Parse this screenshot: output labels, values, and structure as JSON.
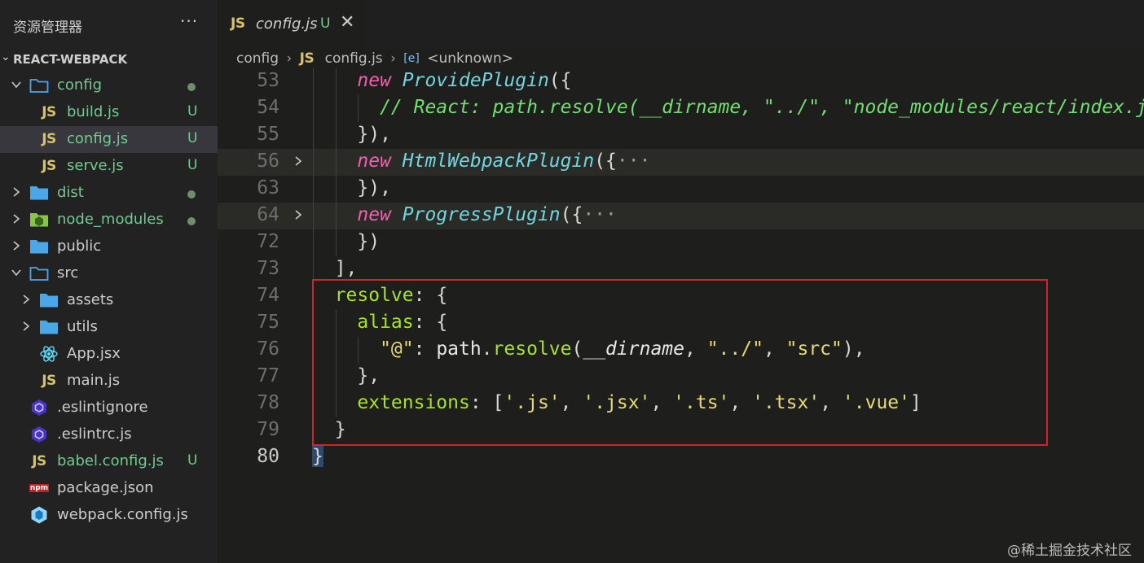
{
  "sidebar": {
    "title": "资源管理器",
    "more": "···",
    "project": "REACT-WEBPACK",
    "items": [
      {
        "name": "config",
        "type": "folder",
        "open": true,
        "depth": 0,
        "status": "dot"
      },
      {
        "name": "build.js",
        "type": "js",
        "depth": 1,
        "status": "U"
      },
      {
        "name": "config.js",
        "type": "js",
        "depth": 1,
        "status": "U",
        "selected": true
      },
      {
        "name": "serve.js",
        "type": "js",
        "depth": 1,
        "status": "U"
      },
      {
        "name": "dist",
        "type": "folder",
        "open": false,
        "depth": 0,
        "status": "dot"
      },
      {
        "name": "node_modules",
        "type": "node-folder",
        "open": false,
        "depth": 0,
        "status": "dot"
      },
      {
        "name": "public",
        "type": "folder",
        "open": false,
        "depth": 0
      },
      {
        "name": "src",
        "type": "folder",
        "open": true,
        "depth": 0
      },
      {
        "name": "assets",
        "type": "folder",
        "open": false,
        "depth": 1
      },
      {
        "name": "utils",
        "type": "folder",
        "open": false,
        "depth": 1
      },
      {
        "name": "App.jsx",
        "type": "react",
        "depth": 1
      },
      {
        "name": "main.js",
        "type": "js",
        "depth": 1
      },
      {
        "name": ".eslintignore",
        "type": "eslint",
        "depth": 0
      },
      {
        "name": ".eslintrc.js",
        "type": "eslint",
        "depth": 0
      },
      {
        "name": "babel.config.js",
        "type": "js",
        "depth": 0,
        "status": "U"
      },
      {
        "name": "package.json",
        "type": "npm",
        "depth": 0
      },
      {
        "name": "webpack.config.js",
        "type": "webpack",
        "depth": 0
      }
    ]
  },
  "icons": {
    "js": "JS",
    "npm": "npm"
  },
  "colors": {
    "accent_folder": "#4aa8e8",
    "js_yellow": "#d6c26a",
    "untracked": "#73c991",
    "modified_dot": "#6d8f6d",
    "highlight_box": "#d3232a"
  },
  "tab": {
    "label": "config.js",
    "status": "U",
    "close": "✕",
    "icon": "JS"
  },
  "breadcrumb": {
    "folder": "config",
    "file": "config.js",
    "symbol": "<unknown>",
    "symbol_icon": "[e]"
  },
  "code": [
    {
      "num": "53",
      "indent": 2,
      "tokens": [
        [
          "k",
          "new"
        ],
        [
          "p",
          " "
        ],
        [
          "cls",
          "ProvidePlugin"
        ],
        [
          "p",
          "({"
        ]
      ]
    },
    {
      "num": "54",
      "indent": 3,
      "tokens": [
        [
          "cm",
          "// React: path.resolve(__dirname, \"../\", \"node_modules/react/index.js\")"
        ]
      ]
    },
    {
      "num": "55",
      "indent": 2,
      "tokens": [
        [
          "p",
          "}),"
        ]
      ]
    },
    {
      "num": "56",
      "indent": 2,
      "fold": true,
      "tokens": [
        [
          "k",
          "new"
        ],
        [
          "p",
          " "
        ],
        [
          "cls",
          "HtmlWebpackPlugin"
        ],
        [
          "p",
          "({"
        ],
        [
          "fold-dots",
          "···"
        ]
      ]
    },
    {
      "num": "63",
      "indent": 2,
      "tokens": [
        [
          "p",
          "}),"
        ]
      ]
    },
    {
      "num": "64",
      "indent": 2,
      "fold": true,
      "tokens": [
        [
          "k",
          "new"
        ],
        [
          "p",
          " "
        ],
        [
          "cls",
          "ProgressPlugin"
        ],
        [
          "p",
          "({"
        ],
        [
          "fold-dots",
          "···"
        ]
      ]
    },
    {
      "num": "72",
      "indent": 2,
      "tokens": [
        [
          "p",
          "})"
        ]
      ]
    },
    {
      "num": "73",
      "indent": 1,
      "tokens": [
        [
          "p",
          "],"
        ]
      ]
    },
    {
      "num": "74",
      "indent": 1,
      "tokens": [
        [
          "key",
          "resolve"
        ],
        [
          "p",
          ": {"
        ]
      ]
    },
    {
      "num": "75",
      "indent": 2,
      "tokens": [
        [
          "key",
          "alias"
        ],
        [
          "p",
          ": {"
        ]
      ]
    },
    {
      "num": "76",
      "indent": 3,
      "tokens": [
        [
          "str",
          "\"@\""
        ],
        [
          "p",
          ": "
        ],
        [
          "var",
          "path"
        ],
        [
          "p",
          "."
        ],
        [
          "fn",
          "resolve"
        ],
        [
          "p",
          "("
        ],
        [
          "var ital",
          "__dirname"
        ],
        [
          "p",
          ", "
        ],
        [
          "str",
          "\"../\""
        ],
        [
          "p",
          ", "
        ],
        [
          "str",
          "\"src\""
        ],
        [
          "p",
          "),"
        ]
      ]
    },
    {
      "num": "77",
      "indent": 2,
      "tokens": [
        [
          "p",
          "},"
        ]
      ]
    },
    {
      "num": "78",
      "indent": 2,
      "tokens": [
        [
          "key",
          "extensions"
        ],
        [
          "p",
          ": ["
        ],
        [
          "str",
          "'.js'"
        ],
        [
          "p",
          ", "
        ],
        [
          "str",
          "'.jsx'"
        ],
        [
          "p",
          ", "
        ],
        [
          "str",
          "'.ts'"
        ],
        [
          "p",
          ", "
        ],
        [
          "str",
          "'.tsx'"
        ],
        [
          "p",
          ", "
        ],
        [
          "str",
          "'.vue'"
        ],
        [
          "p",
          "]"
        ]
      ]
    },
    {
      "num": "79",
      "indent": 1,
      "tokens": [
        [
          "p",
          "}"
        ]
      ]
    },
    {
      "num": "80",
      "indent": 0,
      "active": true,
      "tokens": [
        [
          "p cursor-box",
          "}"
        ]
      ]
    }
  ],
  "watermark": "@稀土掘金技术社区"
}
